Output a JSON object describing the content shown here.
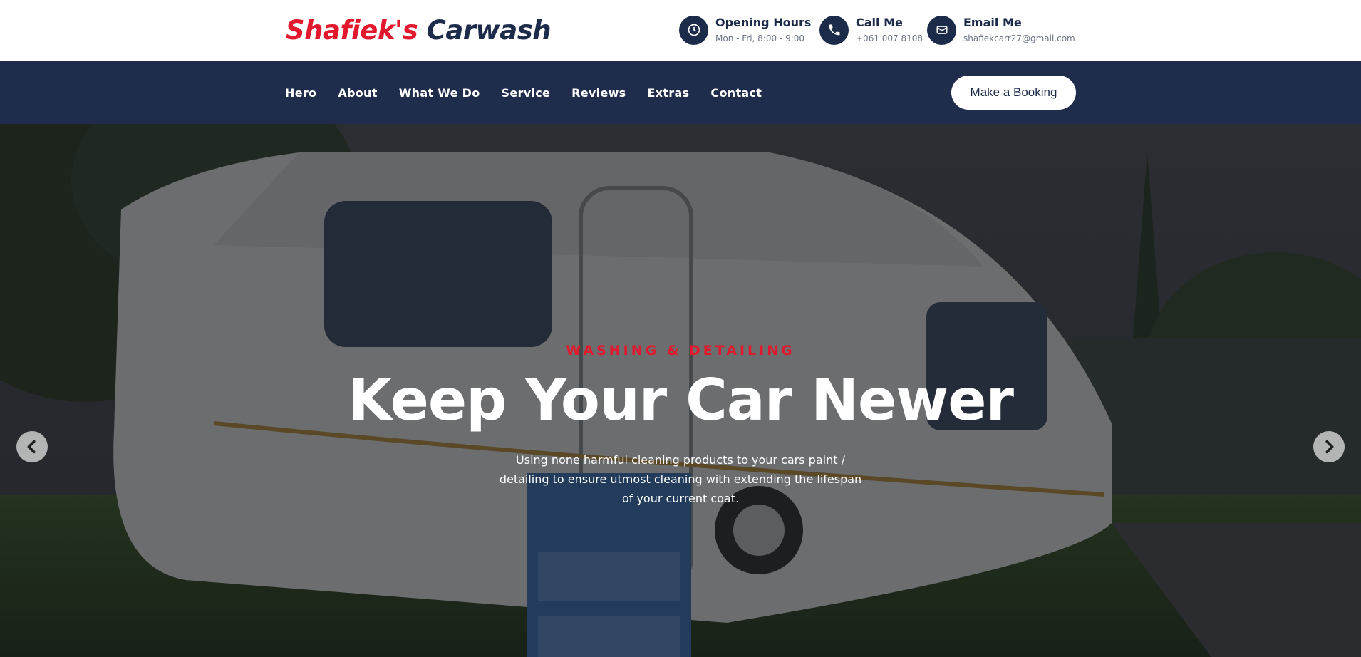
{
  "header": {
    "logo_part1": "Shafiek's",
    "logo_part2": "Carwash",
    "hours": {
      "title": "Opening Hours",
      "value": "Mon - Fri, 8:00 - 9:00",
      "icon": "clock-icon"
    },
    "call": {
      "title": "Call Me",
      "value": "+061 007 8108",
      "icon": "phone-icon"
    },
    "email": {
      "title": "Email Me",
      "value": "shafiekcarr27@gmail.com",
      "icon": "mail-icon"
    }
  },
  "nav": {
    "items": [
      "Hero",
      "About",
      "What We Do",
      "Service",
      "Reviews",
      "Extras",
      "Contact"
    ],
    "booking_label": "Make a Booking"
  },
  "hero": {
    "kicker": "WASHING & DETAILING",
    "headline": "Keep Your Car Newer",
    "subtext": "Using none harmful cleaning products to your cars paint / detailing to ensure utmost cleaning with extending the lifespan of your current coat.",
    "prev_icon": "chevron-left-icon",
    "next_icon": "chevron-right-icon"
  },
  "colors": {
    "accent_red": "#e3182d",
    "navy": "#1d2b4a",
    "navbar": "#1f2c4b"
  }
}
